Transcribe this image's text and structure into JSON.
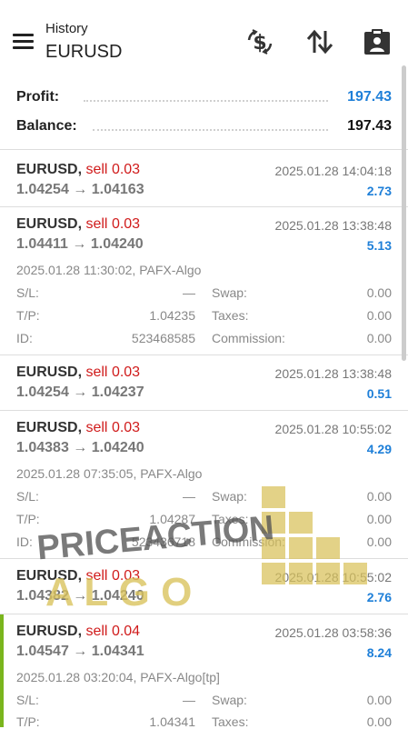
{
  "header": {
    "section_label": "History",
    "symbol": "EURUSD",
    "icons": [
      "currency-exchange-icon",
      "sort-icon",
      "portfolio-icon"
    ]
  },
  "summary": {
    "profit_label": "Profit:",
    "profit_value": "197.43",
    "balance_label": "Balance:",
    "balance_value": "197.43"
  },
  "trades": [
    {
      "symbol": "EURUSD,",
      "side": "sell",
      "volume": "0.03",
      "time": "2025.01.28 14:04:18",
      "open": "1.04254",
      "close": "1.04163",
      "profit": "2.73"
    },
    {
      "symbol": "EURUSD,",
      "side": "sell",
      "volume": "0.03",
      "time": "2025.01.28 13:38:48",
      "open": "1.04411",
      "close": "1.04240",
      "profit": "5.13",
      "details": {
        "opened": "2025.01.28 11:30:02, PAFX-Algo",
        "sl_label": "S/L:",
        "sl": "—",
        "swap_label": "Swap:",
        "swap": "0.00",
        "tp_label": "T/P:",
        "tp": "1.04235",
        "taxes_label": "Taxes:",
        "taxes": "0.00",
        "id_label": "ID:",
        "id": "523468585",
        "commission_label": "Commission:",
        "commission": "0.00"
      }
    },
    {
      "symbol": "EURUSD,",
      "side": "sell",
      "volume": "0.03",
      "time": "2025.01.28 13:38:48",
      "open": "1.04254",
      "close": "1.04237",
      "profit": "0.51"
    },
    {
      "symbol": "EURUSD,",
      "side": "sell",
      "volume": "0.03",
      "time": "2025.01.28 10:55:02",
      "open": "1.04383",
      "close": "1.04240",
      "profit": "4.29",
      "details": {
        "opened": "2025.01.28 07:35:05, PAFX-Algo",
        "sl_label": "S/L:",
        "sl": "—",
        "swap_label": "Swap:",
        "swap": "0.00",
        "tp_label": "T/P:",
        "tp": "1.04287",
        "taxes_label": "Taxes:",
        "taxes": "0.00",
        "id_label": "ID:",
        "id": "523436718",
        "commission_label": "Commission:",
        "commission": "0.00"
      }
    },
    {
      "symbol": "EURUSD,",
      "side": "sell",
      "volume": "0.03",
      "time": "2025.01.28 10:55:02",
      "open": "1.04382",
      "close": "1.04240",
      "profit": "2.76"
    },
    {
      "symbol": "EURUSD,",
      "side": "sell",
      "volume": "0.04",
      "time": "2025.01.28 03:58:36",
      "open": "1.04547",
      "close": "1.04341",
      "profit": "8.24",
      "details": {
        "opened": "2025.01.28 03:20:04, PAFX-Algo[tp]",
        "sl_label": "S/L:",
        "sl": "—",
        "swap_label": "Swap:",
        "swap": "0.00",
        "tp_label": "T/P:",
        "tp": "1.04341",
        "taxes_label": "Taxes:",
        "taxes": "0.00"
      }
    }
  ],
  "arrow": "→",
  "watermark": {
    "line1": "PRICEACTION",
    "line2": "A L G O"
  },
  "colors": {
    "profit_blue": "#1e7fd8",
    "sell_red": "#d01b1b",
    "accent_green": "#7ab51d",
    "watermark_gold": "#d9c25a"
  }
}
